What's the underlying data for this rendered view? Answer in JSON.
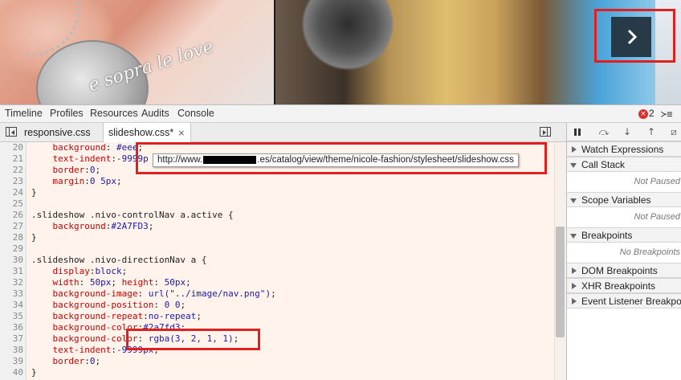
{
  "preview": {
    "pendant_text": "e sopra le love",
    "next_button_glyph": "›"
  },
  "toolbar": {
    "tabs": [
      "Timeline",
      "Profiles",
      "Resources",
      "Audits",
      "Console"
    ],
    "error_count": "2",
    "error_icon": "×",
    "drawer_icon": "≻≡"
  },
  "files": {
    "tabs": [
      {
        "label": "responsive.css"
      },
      {
        "label": "slideshow.css*",
        "close": "×"
      }
    ]
  },
  "editor": {
    "lines": [
      {
        "n": "20",
        "html": "    <span class=\"p\">background</span>: <span class=\"v\">#eee</span>;"
      },
      {
        "n": "21",
        "html": "    <span class=\"p\">text-indent</span>:<span class=\"v\">-9999p</span>"
      },
      {
        "n": "22",
        "html": "    <span class=\"p\">border</span>:<span class=\"v\">0</span>;"
      },
      {
        "n": "23",
        "html": "    <span class=\"p\">margin</span>:<span class=\"v\">0 5px</span>;"
      },
      {
        "n": "24",
        "html": "}"
      },
      {
        "n": "25",
        "html": ""
      },
      {
        "n": "26",
        "html": ".slideshow .nivo-controlNav a.active {"
      },
      {
        "n": "27",
        "html": "    <span class=\"p\">background</span>:<span class=\"v\">#2A7FD3</span>;"
      },
      {
        "n": "28",
        "html": "}"
      },
      {
        "n": "29",
        "html": ""
      },
      {
        "n": "30",
        "html": ".slideshow .nivo-directionNav a {"
      },
      {
        "n": "31",
        "html": "    <span class=\"p\">display</span>:<span class=\"v\">block</span>;"
      },
      {
        "n": "32",
        "html": "    <span class=\"p\">width</span>: <span class=\"v\">50px</span>; <span class=\"p\">height</span>: <span class=\"v\">50px</span>;"
      },
      {
        "n": "33",
        "html": "    <span class=\"p\">background-image</span>: <span class=\"v\">url(</span><span class=\"s\">\"../image/nav.png\"</span><span class=\"v\">)</span>;"
      },
      {
        "n": "34",
        "html": "    <span class=\"p\">background-position</span>: <span class=\"v\">0 0</span>;"
      },
      {
        "n": "35",
        "html": "    <span class=\"p\">background-repeat</span>:<span class=\"v\">no-repeat</span>;"
      },
      {
        "n": "36",
        "html": "    <span class=\"p\">background-color</span>:<span class=\"v\">#2a7fd3</span>;"
      },
      {
        "n": "37",
        "html": "    <span class=\"p\">background-color</span>: <span class=\"v\">rgba(3, 2, 1, 1)</span>;"
      },
      {
        "n": "38",
        "html": "    <span class=\"p\">text-indent</span>:<span class=\"v\">-9999px</span>;"
      },
      {
        "n": "39",
        "html": "    <span class=\"p\">border</span>:<span class=\"v\">0</span>;"
      },
      {
        "n": "40",
        "html": "}"
      }
    ],
    "tooltip": {
      "prefix": "http://www.",
      "suffix": ".es/catalog/view/theme/nicole-fashion/stylesheet/slideshow.css"
    }
  },
  "sidebar": {
    "panes": [
      {
        "title": "Watch Expressions",
        "expanded": false
      },
      {
        "title": "Call Stack",
        "expanded": true,
        "body": "Not Paused"
      },
      {
        "title": "Scope Variables",
        "expanded": true,
        "body": "Not Paused"
      },
      {
        "title": "Breakpoints",
        "expanded": true,
        "body": "No Breakpoints"
      },
      {
        "title": "DOM Breakpoints",
        "expanded": false
      },
      {
        "title": "XHR Breakpoints",
        "expanded": false
      },
      {
        "title": "Event Listener Breakpoints",
        "expanded": false
      }
    ]
  },
  "colors": {
    "highlight_red": "#e0201f",
    "nav_button": "#263a47",
    "editor_bg": "#fff3ec",
    "css_property": "#c80000",
    "css_value": "#1a1aa6"
  }
}
